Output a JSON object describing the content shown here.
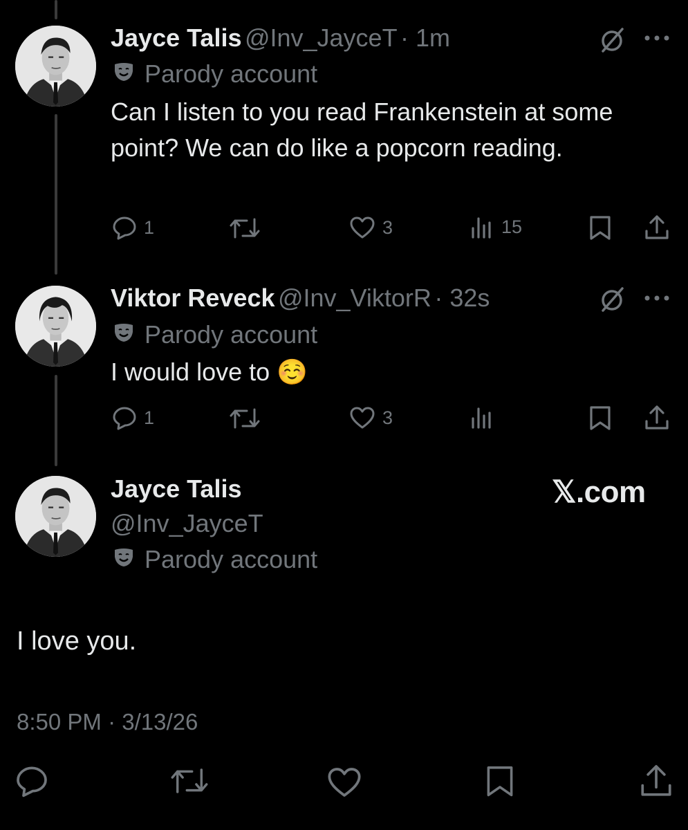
{
  "tweets": [
    {
      "name": "Jayce Talis",
      "handle": "@Inv_JayceT",
      "time": "· 1m",
      "badge": "Parody account",
      "text": "Can I listen to you read Frankenstein at some point? We can do like a popcorn reading.",
      "replies": "1",
      "likes": "3",
      "views": "15"
    },
    {
      "name": "Viktor Reveck",
      "handle": "@Inv_ViktorR",
      "time": "· 32s",
      "badge": "Parody account",
      "text": "I would love to ☺️",
      "replies": "1",
      "likes": "3",
      "views": ""
    }
  ],
  "main": {
    "name": "Jayce Talis",
    "handle": "@Inv_JayceT",
    "badge": "Parody account",
    "text": "I love you.",
    "timestamp": "8:50 PM · 3/13/26"
  },
  "watermark": "𝕏.com",
  "icons": [
    "grok-icon",
    "more-icon",
    "reply-icon",
    "retweet-icon",
    "like-icon",
    "views-icon",
    "bookmark-icon",
    "share-icon",
    "parody-mask-icon"
  ]
}
